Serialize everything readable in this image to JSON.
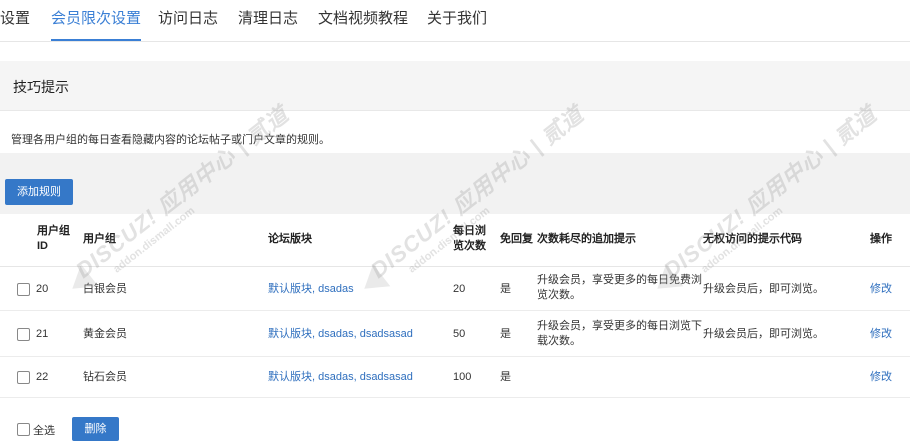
{
  "tabs": [
    "设置",
    "会员限次设置",
    "访问日志",
    "清理日志",
    "文档视频教程",
    "关于我们"
  ],
  "active_tab": 1,
  "tips": {
    "title": "技巧提示",
    "description": "管理各用户组的每日查看隐藏内容的论坛帖子或门户文章的规则。"
  },
  "toolbar": {
    "add_label": "添加规则"
  },
  "table": {
    "headers": {
      "group_id": [
        "用户组",
        "ID"
      ],
      "group": "用户组",
      "forum": "论坛版块",
      "daily": [
        "每日浏",
        "览次数"
      ],
      "free_reply": "免回复",
      "hint": "次数耗尽的追加提示",
      "no_access": "无权访问的提示代码",
      "action": "操作"
    },
    "rows": [
      {
        "id": "20",
        "group": "白银会员",
        "forum": "默认版块, dsadas",
        "daily": "20",
        "free_reply": "是",
        "hint": [
          "升级会员，享受更多的每日免费浏",
          "览次数。"
        ],
        "no_access": "升级会员后，即可浏览。",
        "action": "修改"
      },
      {
        "id": "21",
        "group": "黄金会员",
        "forum": "默认版块, dsadas, dsadsasad",
        "daily": "50",
        "free_reply": "是",
        "hint": [
          "升级会员，享受更多的每日浏览下",
          "载次数。"
        ],
        "no_access": "升级会员后，即可浏览。",
        "action": "修改"
      },
      {
        "id": "22",
        "group": "钻石会员",
        "forum": "默认版块, dsadas, dsadsasad",
        "daily": "100",
        "free_reply": "是",
        "hint": [
          "",
          ""
        ],
        "no_access": "",
        "action": "修改"
      }
    ]
  },
  "footer": {
    "select_all": "全选",
    "delete_label": "删除"
  },
  "watermark": {
    "brand": "DISCUZ! 应用中心 | 贰道",
    "url": "addon.dismall.com"
  },
  "colors": {
    "accent": "#3a7fd5",
    "button": "#3578c8",
    "link": "#2f6fbe"
  }
}
